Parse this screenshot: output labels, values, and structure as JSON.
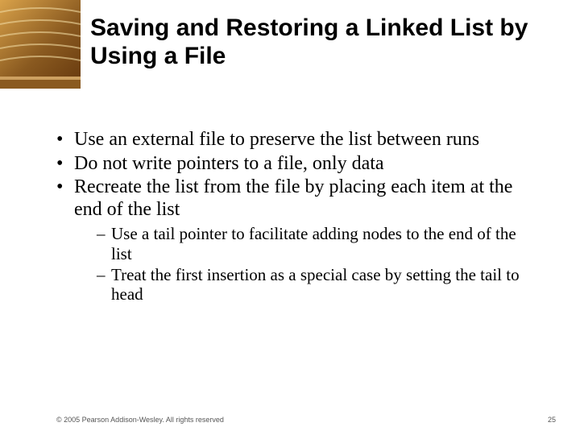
{
  "title": "Saving and Restoring a Linked List by Using a File",
  "bullets": [
    {
      "text": "Use an external file to preserve the list between runs"
    },
    {
      "text": "Do not write pointers to a file, only data"
    },
    {
      "text": "Recreate the list from the file by placing each item at the end of the list",
      "sub": [
        "Use a tail pointer to facilitate adding nodes to the end of the list",
        "Treat the first insertion as a special case by setting the tail to head"
      ]
    }
  ],
  "footer": {
    "copyright": "© 2005 Pearson Addison-Wesley. All rights reserved",
    "page": "25"
  }
}
